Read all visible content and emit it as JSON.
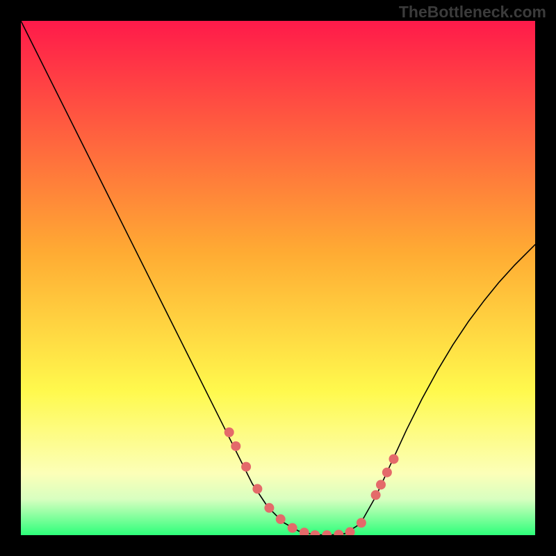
{
  "watermark": "TheBottleneck.com",
  "colors": {
    "background": "#000000",
    "gradient_top": "#ff1a4a",
    "gradient_mid": "#ffc733",
    "gradient_yellow": "#fff94d",
    "gradient_pale": "#fcffd1",
    "gradient_green": "#2dff7a",
    "curve": "#000000",
    "marker": "#e46a6a"
  },
  "chart_data": {
    "type": "line",
    "title": "",
    "xlabel": "",
    "ylabel": "",
    "xlim": [
      0,
      1
    ],
    "ylim": [
      0,
      1
    ],
    "series": [
      {
        "name": "bottleneck-curve",
        "x": [
          0.0,
          0.03,
          0.06,
          0.09,
          0.12,
          0.15,
          0.18,
          0.21,
          0.24,
          0.27,
          0.3,
          0.33,
          0.36,
          0.39,
          0.42,
          0.45,
          0.48,
          0.51,
          0.54,
          0.57,
          0.6,
          0.63,
          0.66,
          0.69,
          0.72,
          0.75,
          0.78,
          0.81,
          0.84,
          0.87,
          0.9,
          0.93,
          0.96,
          1.0
        ],
        "y": [
          1.0,
          0.94,
          0.88,
          0.82,
          0.76,
          0.7,
          0.64,
          0.58,
          0.52,
          0.46,
          0.4,
          0.34,
          0.28,
          0.22,
          0.16,
          0.1,
          0.055,
          0.025,
          0.008,
          0.001,
          0.0,
          0.003,
          0.022,
          0.075,
          0.14,
          0.205,
          0.265,
          0.32,
          0.37,
          0.415,
          0.455,
          0.492,
          0.525,
          0.565
        ]
      }
    ],
    "markers": {
      "name": "highlighted-points",
      "x": [
        0.405,
        0.418,
        0.438,
        0.46,
        0.483,
        0.505,
        0.528,
        0.551,
        0.572,
        0.595,
        0.618,
        0.64,
        0.662,
        0.69,
        0.7,
        0.712,
        0.725
      ],
      "y": [
        0.2,
        0.173,
        0.133,
        0.09,
        0.053,
        0.031,
        0.014,
        0.005,
        0.0,
        0.0,
        0.001,
        0.006,
        0.024,
        0.078,
        0.098,
        0.122,
        0.148
      ]
    }
  }
}
